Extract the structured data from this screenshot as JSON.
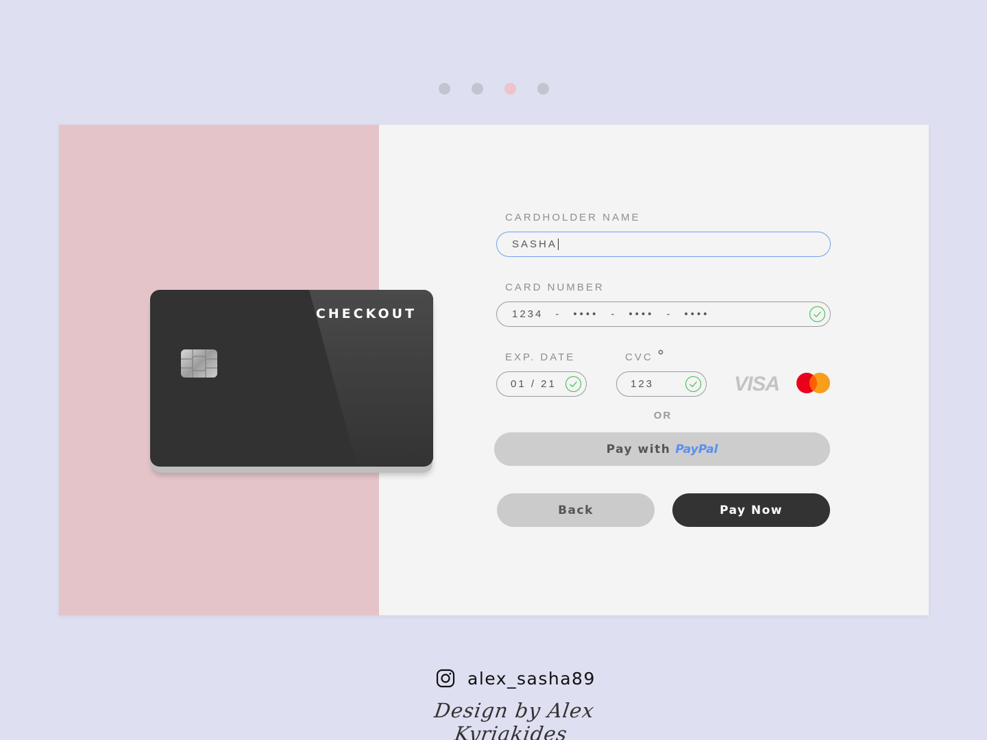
{
  "pager": {
    "dots": [
      "step-1",
      "step-2",
      "step-3",
      "step-4"
    ],
    "active_index": 2
  },
  "card": {
    "brand_text": "CHECKOUT"
  },
  "form": {
    "cardholder": {
      "label": "CARDHOLDER NAME",
      "value": "SASHA"
    },
    "card_number": {
      "label": "CARD NUMBER",
      "first_group": "1234",
      "masked_group": "••••",
      "separator": "-"
    },
    "exp_date": {
      "label": "EXP. DATE",
      "value": "01 / 21"
    },
    "cvc": {
      "label": "CVC",
      "value": "123"
    },
    "brands": {
      "visa": "VISA",
      "mastercard_icon": "mastercard-icon"
    },
    "or_text": "OR"
  },
  "buttons": {
    "paypal_prefix": "Pay with",
    "paypal_brand": "PayPal",
    "back": "Back",
    "pay_now": "Pay Now"
  },
  "footer": {
    "instagram_handle": "alex_sasha89",
    "credit": "Design by Alex Kyriakides"
  },
  "colors": {
    "background": "#dedff1",
    "left_panel": "#e4c4c8",
    "right_panel": "#f4f4f4",
    "card": "#323232",
    "accent_focus": "#6f9ef0",
    "valid_check": "#5cc26a",
    "paypal_blue": "#5b8ef0",
    "mastercard_red": "#eb001b",
    "mastercard_orange": "#f79e1b"
  }
}
